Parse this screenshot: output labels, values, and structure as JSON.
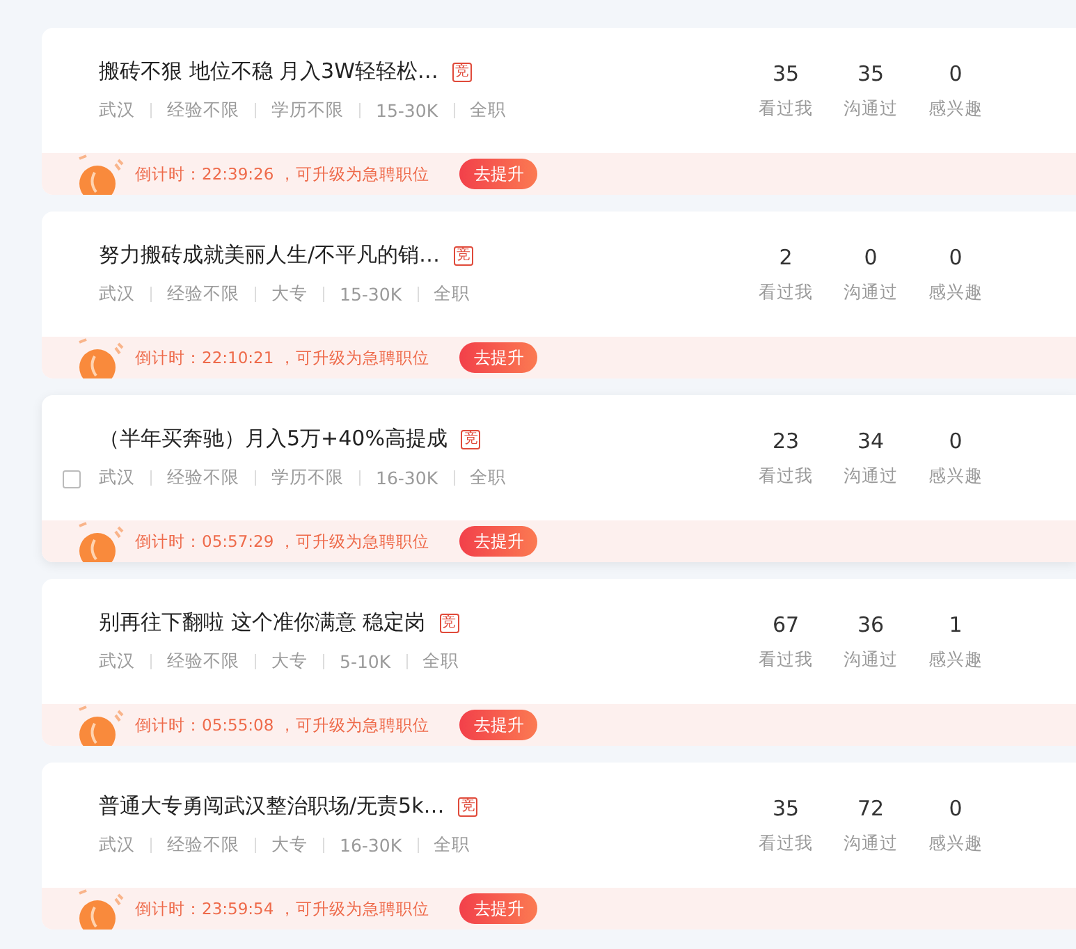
{
  "jobs": [
    {
      "title": "搬砖不狠 地位不稳 月入3W轻轻松…",
      "badge": "竞",
      "show_checkbox": false,
      "meta": [
        "武汉",
        "经验不限",
        "学历不限",
        "15-30K",
        "全职"
      ],
      "stats": [
        {
          "value": "35",
          "label": "看过我"
        },
        {
          "value": "35",
          "label": "沟通过"
        },
        {
          "value": "0",
          "label": "感兴趣"
        }
      ],
      "countdown": "倒计时：22:39:26 ，可升级为急聘职位",
      "button": "去提升"
    },
    {
      "title": "努力搬砖成就美丽人生/不平凡的销…",
      "badge": "竞",
      "show_checkbox": false,
      "meta": [
        "武汉",
        "经验不限",
        "大专",
        "15-30K",
        "全职"
      ],
      "stats": [
        {
          "value": "2",
          "label": "看过我"
        },
        {
          "value": "0",
          "label": "沟通过"
        },
        {
          "value": "0",
          "label": "感兴趣"
        }
      ],
      "countdown": "倒计时：22:10:21 ，可升级为急聘职位",
      "button": "去提升"
    },
    {
      "title": "（半年买奔驰）月入5万+40%高提成",
      "badge": "竞",
      "show_checkbox": true,
      "checked": false,
      "meta": [
        "武汉",
        "经验不限",
        "学历不限",
        "16-30K",
        "全职"
      ],
      "stats": [
        {
          "value": "23",
          "label": "看过我"
        },
        {
          "value": "34",
          "label": "沟通过"
        },
        {
          "value": "0",
          "label": "感兴趣"
        }
      ],
      "countdown": "倒计时：05:57:29 ，可升级为急聘职位",
      "button": "去提升"
    },
    {
      "title": "别再往下翻啦 这个准你满意 稳定岗",
      "badge": "竞",
      "show_checkbox": false,
      "meta": [
        "武汉",
        "经验不限",
        "大专",
        "5-10K",
        "全职"
      ],
      "stats": [
        {
          "value": "67",
          "label": "看过我"
        },
        {
          "value": "36",
          "label": "沟通过"
        },
        {
          "value": "1",
          "label": "感兴趣"
        }
      ],
      "countdown": "倒计时：05:55:08 ，可升级为急聘职位",
      "button": "去提升"
    },
    {
      "title": "普通大专勇闯武汉整治职场/无责5k…",
      "badge": "竞",
      "show_checkbox": false,
      "meta": [
        "武汉",
        "经验不限",
        "大专",
        "16-30K",
        "全职"
      ],
      "stats": [
        {
          "value": "35",
          "label": "看过我"
        },
        {
          "value": "72",
          "label": "沟通过"
        },
        {
          "value": "0",
          "label": "感兴趣"
        }
      ],
      "countdown": "倒计时：23:59:54 ，可升级为急聘职位",
      "button": "去提升"
    }
  ]
}
